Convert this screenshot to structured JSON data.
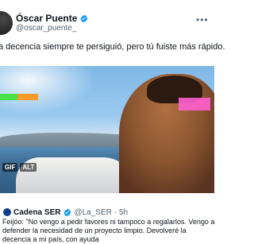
{
  "author": {
    "name": "Óscar Puente",
    "handle": "@oscar_puente_"
  },
  "post": {
    "text": "a decencia siempre te persiguió, pero tú fuiste más rápido."
  },
  "media": {
    "badges": [
      "GIF",
      "ALT"
    ]
  },
  "quote": {
    "name": "Cadena SER",
    "handle": "@La_SER",
    "time": "· 5h",
    "text": "Feijóo: \"No vengo a pedir favores ni tampoco a regalarlos. Vengo a defender la necesidad de un proyecto limpio. Devolveré la decencia a mi país, con ayuda"
  },
  "colors": {
    "verified": "#1d9bf0",
    "muted": "#536471"
  },
  "icons": {
    "verified": "verified-badge-icon",
    "more": "more-options-icon"
  }
}
